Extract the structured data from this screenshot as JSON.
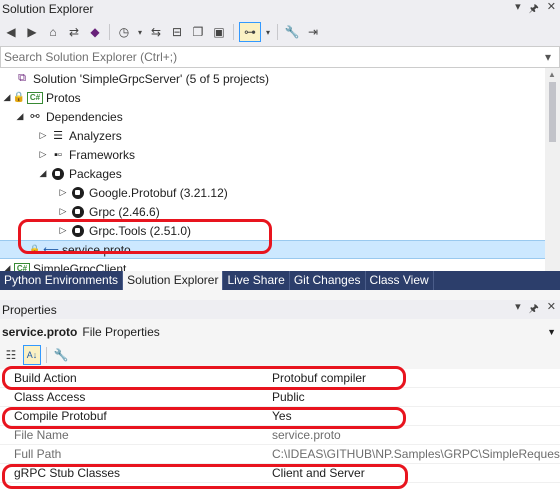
{
  "solution_explorer": {
    "title": "Solution Explorer",
    "search_placeholder": "Search Solution Explorer (Ctrl+;)",
    "tree": [
      {
        "label": "Solution 'SimpleGrpcServer' (5 of 5 projects)",
        "icon": "solution-icon"
      },
      {
        "label": "Protos",
        "icon": "csharp-project-icon",
        "expanded": true
      },
      {
        "label": "Dependencies",
        "icon": "dependencies-icon",
        "expanded": true
      },
      {
        "label": "Analyzers",
        "icon": "analyzers-icon"
      },
      {
        "label": "Frameworks",
        "icon": "frameworks-icon"
      },
      {
        "label": "Packages",
        "icon": "packages-icon",
        "expanded": true
      },
      {
        "label": "Google.Protobuf (3.21.12)",
        "icon": "package-icon"
      },
      {
        "label": "Grpc (2.46.6)",
        "icon": "package-icon"
      },
      {
        "label": "Grpc.Tools (2.51.0)",
        "icon": "package-icon"
      },
      {
        "label": "service.proto",
        "icon": "proto-file-icon",
        "selected": true
      },
      {
        "label": "SimpleGrpcClient",
        "icon": "csharp-project-icon"
      }
    ]
  },
  "tabs": [
    "Python Environments",
    "Solution Explorer",
    "Live Share",
    "Git Changes",
    "Class View"
  ],
  "active_tab": "Solution Explorer",
  "properties": {
    "title": "Properties",
    "object_name": "service.proto",
    "object_type": "File Properties",
    "rows": [
      {
        "name": "Build Action",
        "value": "Protobuf compiler",
        "readonly": false
      },
      {
        "name": "Class Access",
        "value": "Public",
        "readonly": false
      },
      {
        "name": "Compile Protobuf",
        "value": "Yes",
        "readonly": false
      },
      {
        "name": "File Name",
        "value": "service.proto",
        "readonly": true
      },
      {
        "name": "Full Path",
        "value": "C:\\IDEAS\\GITHUB\\NP.Samples\\GRPC\\SimpleRequestR",
        "readonly": true
      },
      {
        "name": "gRPC Stub Classes",
        "value": "Client and Server",
        "readonly": false
      }
    ]
  },
  "colors": {
    "accent": "#2c3e6b",
    "selection": "#cce8ff",
    "highlight_marker": "#e8141e"
  }
}
